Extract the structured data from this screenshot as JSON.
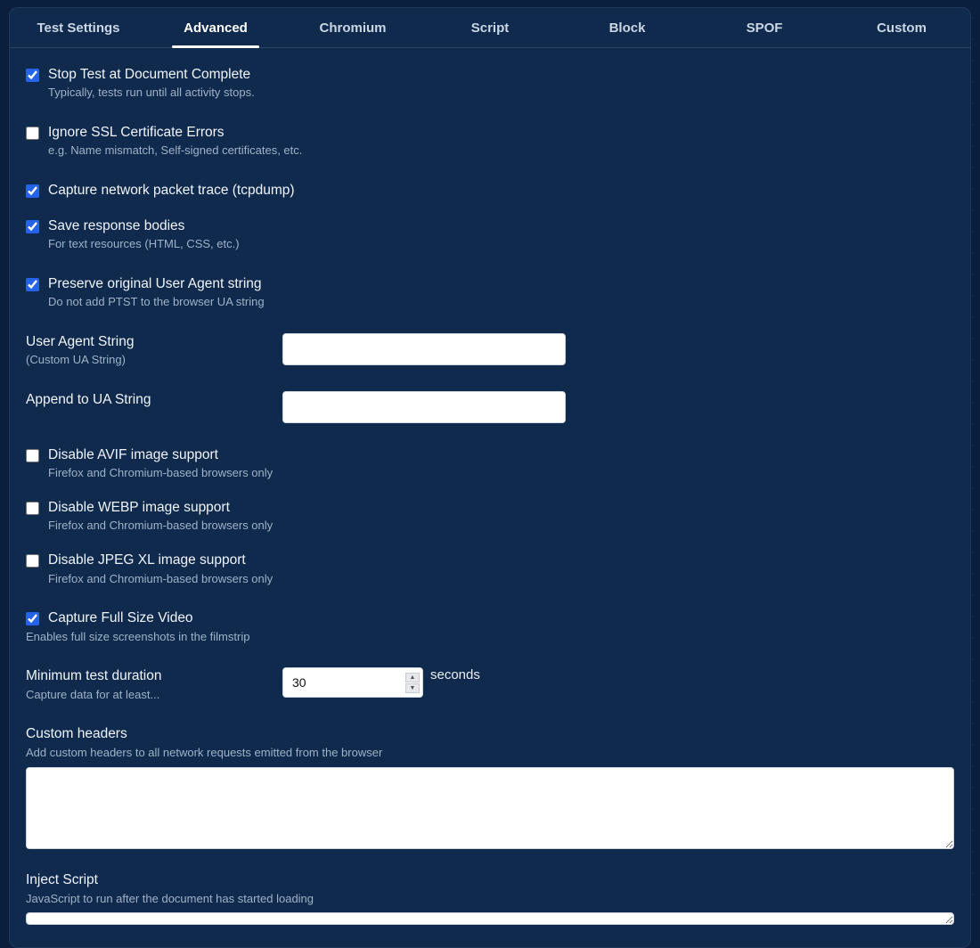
{
  "tabs": [
    {
      "label": "Test Settings"
    },
    {
      "label": "Advanced"
    },
    {
      "label": "Chromium"
    },
    {
      "label": "Script"
    },
    {
      "label": "Block"
    },
    {
      "label": "SPOF"
    },
    {
      "label": "Custom"
    }
  ],
  "active_tab_index": 1,
  "options": {
    "stop_doc_complete": {
      "label": "Stop Test at Document Complete",
      "hint": "Typically, tests run until all activity stops.",
      "checked": true
    },
    "ignore_ssl": {
      "label": "Ignore SSL Certificate Errors",
      "hint": "e.g. Name mismatch, Self-signed certificates, etc.",
      "checked": false
    },
    "tcpdump": {
      "label": "Capture network packet trace (tcpdump)",
      "checked": true
    },
    "save_bodies": {
      "label": "Save response bodies",
      "hint": "For text resources (HTML, CSS, etc.)",
      "checked": true
    },
    "preserve_ua": {
      "label": "Preserve original User Agent string",
      "hint": "Do not add PTST to the browser UA string",
      "checked": true
    },
    "disable_avif": {
      "label": "Disable AVIF image support",
      "hint": "Firefox and Chromium-based browsers only",
      "checked": false
    },
    "disable_webp": {
      "label": "Disable WEBP image support",
      "hint": "Firefox and Chromium-based browsers only",
      "checked": false
    },
    "disable_jxl": {
      "label": "Disable JPEG XL image support",
      "hint": "Firefox and Chromium-based browsers only",
      "checked": false
    },
    "full_video": {
      "label": "Capture Full Size Video",
      "hint": "Enables full size screenshots in the filmstrip",
      "checked": true
    }
  },
  "fields": {
    "ua_string": {
      "label": "User Agent String",
      "hint": "(Custom UA String)",
      "value": ""
    },
    "append_ua": {
      "label": "Append to UA String",
      "value": ""
    },
    "min_duration": {
      "label": "Minimum test duration",
      "hint": "Capture data for at least...",
      "value": "30",
      "suffix": "seconds"
    },
    "custom_headers": {
      "label": "Custom headers",
      "hint": "Add custom headers to all network requests emitted from the browser",
      "value": ""
    },
    "inject_script": {
      "label": "Inject Script",
      "hint": "JavaScript to run after the document has started loading",
      "value": ""
    }
  }
}
